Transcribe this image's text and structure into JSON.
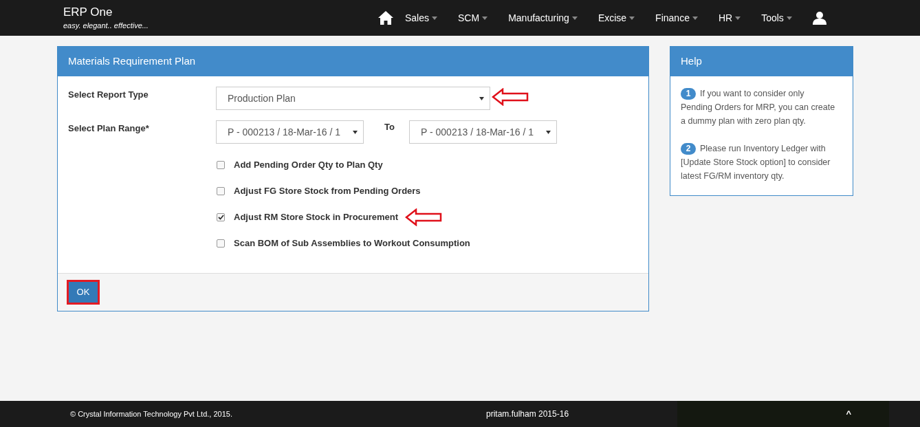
{
  "brand": {
    "name": "ERP One",
    "tagline": "easy. elegant.. effective..."
  },
  "nav": {
    "items": [
      {
        "label": "Sales"
      },
      {
        "label": "SCM"
      },
      {
        "label": "Manufacturing"
      },
      {
        "label": "Excise"
      },
      {
        "label": "Finance"
      },
      {
        "label": "HR"
      },
      {
        "label": "Tools"
      }
    ]
  },
  "form": {
    "title": "Materials Requirement Plan",
    "report_type": {
      "label": "Select Report Type",
      "value": "Production Plan",
      "annotated": true
    },
    "plan_range": {
      "label": "Select Plan Range*",
      "from": "P - 000213 / 18-Mar-16 / 1",
      "to_label": "To",
      "to": "P - 000213 / 18-Mar-16 / 1"
    },
    "options": [
      {
        "label": "Add Pending Order Qty to Plan Qty",
        "checked": false,
        "annotated": false
      },
      {
        "label": "Adjust FG Store Stock from Pending Orders",
        "checked": false,
        "annotated": false
      },
      {
        "label": "Adjust RM Store Stock in Procurement",
        "checked": true,
        "annotated": true
      },
      {
        "label": "Scan BOM of Sub Assemblies to Workout Consumption",
        "checked": false,
        "annotated": false
      }
    ],
    "ok_button": {
      "label": "OK",
      "highlighted": true
    }
  },
  "help": {
    "title": "Help",
    "items": [
      {
        "number": "1",
        "text": "If you want to consider only Pending Orders for MRP, you can create a dummy plan with zero plan qty."
      },
      {
        "number": "2",
        "text": "Please run Inventory Ledger with [Update Store Stock option] to consider latest FG/RM inventory qty."
      }
    ]
  },
  "footer": {
    "copyright": "© Crystal Information Technology Pvt Ltd., 2015.",
    "user": "pritam.fulham 2015-16",
    "scroll_top": "^"
  }
}
